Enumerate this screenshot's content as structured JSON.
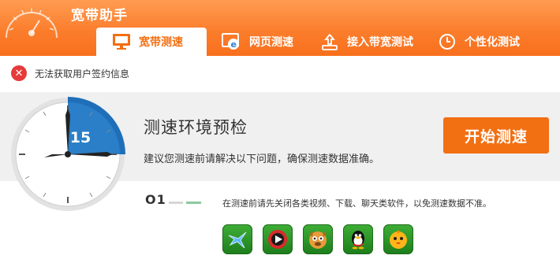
{
  "app": {
    "title": "宽带助手"
  },
  "tabs": [
    {
      "label": "宽带测速",
      "icon": "monitor-icon",
      "active": true
    },
    {
      "label": "网页测速",
      "icon": "ie-browser-icon",
      "active": false
    },
    {
      "label": "接入带宽测试",
      "icon": "upload-icon",
      "active": false
    },
    {
      "label": "个性化测试",
      "icon": "clock-icon",
      "active": false
    }
  ],
  "notice": {
    "icon": "error-x-icon",
    "text": "无法获取用户签约信息"
  },
  "panel": {
    "timer_value": "15",
    "title": "测速环境预检",
    "description": "建议您测速前请解决以下问题，确保测速数据准确。",
    "start_button": "开始测速"
  },
  "step": {
    "number": "O1",
    "text": "在测速前请先关闭各类视频、下载、聊天类软件，以免测速数据不准。",
    "apps": [
      {
        "icon": "xunlei-bird-icon"
      },
      {
        "icon": "video-player-icon"
      },
      {
        "icon": "dog-mascot-icon"
      },
      {
        "icon": "qq-penguin-icon"
      },
      {
        "icon": "chick-mascot-icon"
      }
    ]
  },
  "colors": {
    "brand_orange": "#f26f12",
    "clock_blue": "#1f6fb8",
    "app_green": "#2e9a2a",
    "error_red": "#e63a3a"
  }
}
